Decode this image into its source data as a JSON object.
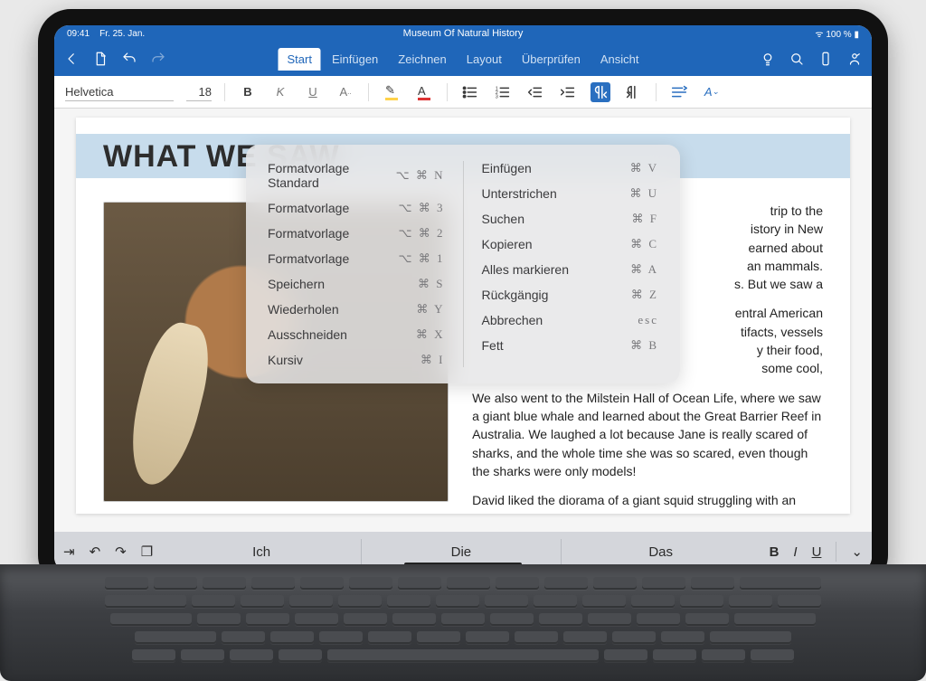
{
  "status": {
    "time": "09:41",
    "date": "Fr. 25. Jan.",
    "battery": "100 %",
    "title": "Museum Of Natural History"
  },
  "ribbon_tabs": [
    "Start",
    "Einfügen",
    "Zeichnen",
    "Layout",
    "Überprüfen",
    "Ansicht"
  ],
  "font": {
    "name": "Helvetica",
    "size": "18"
  },
  "doc": {
    "heading": "WHAT WE SAW",
    "p1": "trip to the",
    "p1b": "istory in New",
    "p1c": "earned about",
    "p1d": "an mammals.",
    "p1e": "s. But we saw a",
    "p2a": "entral American",
    "p2b": "tifacts, vessels",
    "p2c": "y their food,",
    "p2d": "some cool,",
    "p3": "We also went to the Milstein Hall of Ocean Life, where we saw a giant blue whale and learned about the Great Barrier Reef in Australia. We laughed a lot because Jane is really scared of sharks, and the whole time she was so scared, even though the sharks were only models!",
    "p4": "David liked the diorama of a giant squid struggling with an even larger sperm whale. In the rest of this report, we'll tell you more about our favorite"
  },
  "shortcuts": {
    "left": [
      {
        "label": "Formatvorlage Standard",
        "keys": "⌥ ⌘ N"
      },
      {
        "label": "Formatvorlage",
        "keys": "⌥ ⌘ 3"
      },
      {
        "label": "Formatvorlage",
        "keys": "⌥ ⌘ 2"
      },
      {
        "label": "Formatvorlage",
        "keys": "⌥ ⌘ 1"
      },
      {
        "label": "Speichern",
        "keys": "⌘ S"
      },
      {
        "label": "Wiederholen",
        "keys": "⌘ Y"
      },
      {
        "label": "Ausschneiden",
        "keys": "⌘ X"
      },
      {
        "label": "Kursiv",
        "keys": "⌘ I"
      }
    ],
    "right": [
      {
        "label": "Einfügen",
        "keys": "⌘ V"
      },
      {
        "label": "Unterstrichen",
        "keys": "⌘ U"
      },
      {
        "label": "Suchen",
        "keys": "⌘ F"
      },
      {
        "label": "Kopieren",
        "keys": "⌘ C"
      },
      {
        "label": "Alles markieren",
        "keys": "⌘ A"
      },
      {
        "label": "Rückgängig",
        "keys": "⌘ Z"
      },
      {
        "label": "Abbrechen",
        "keys": "esc"
      },
      {
        "label": "Fett",
        "keys": "⌘ B"
      }
    ]
  },
  "quicktype": {
    "s1": "Ich",
    "s2": "Die",
    "s3": "Das"
  },
  "fmt_labels": {
    "bold": "B",
    "italic": "I",
    "underline": "U",
    "strike": "A",
    "font_a": "A"
  }
}
